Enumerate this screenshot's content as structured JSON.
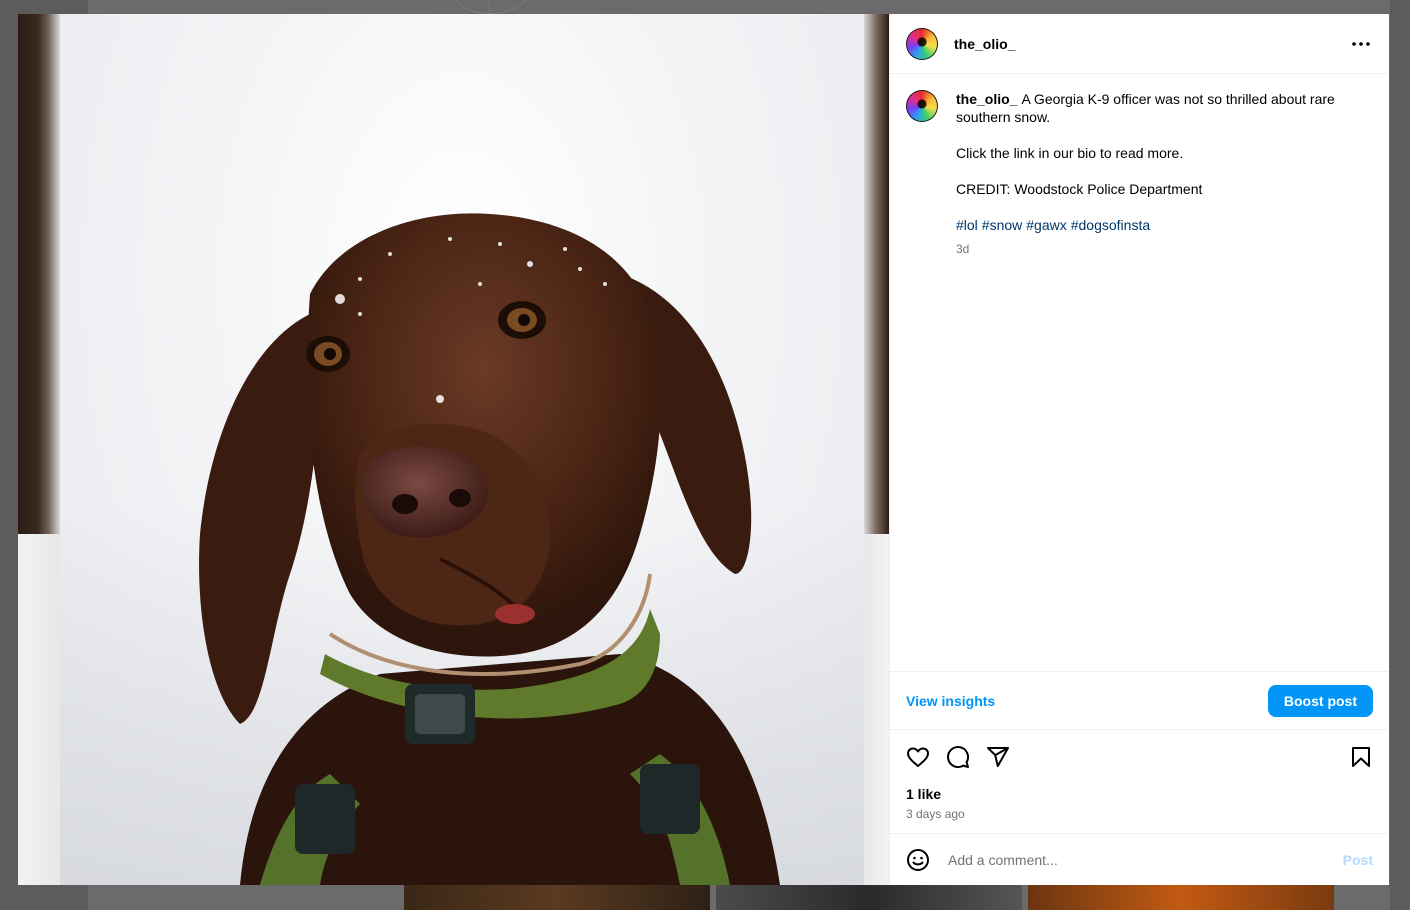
{
  "post": {
    "username": "the_olio_",
    "caption_lines": [
      "A Georgia K-9 officer was not so thrilled about rare",
      "southern snow.",
      "Click the link in our bio to read more.",
      "CREDIT: Woodstock Police Department"
    ],
    "hashtags": [
      "#lol",
      "#snow",
      "#gawx",
      "#dogsofinsta"
    ],
    "caption_time": "3d",
    "likes": "1 like",
    "date": "3 days ago"
  },
  "insights": {
    "view_label": "View insights",
    "boost_label": "Boost post"
  },
  "comment": {
    "placeholder": "Add a comment...",
    "post_label": "Post"
  },
  "icons": {
    "more": "more-options-icon",
    "like": "heart-icon",
    "comment": "comment-bubble-icon",
    "share": "paper-plane-icon",
    "save": "bookmark-icon",
    "emoji": "emoji-smiley-icon"
  },
  "colors": {
    "accent": "#0095f6",
    "hashtag": "#00376b",
    "muted": "#737373",
    "post_disabled": "#b3dbff"
  }
}
